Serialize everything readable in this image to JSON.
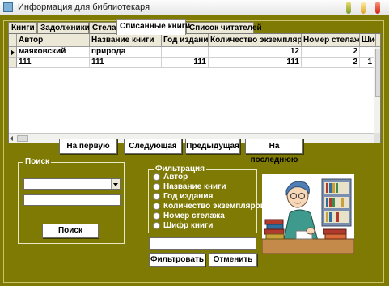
{
  "window": {
    "title": "Информация для библиотекаря"
  },
  "tabs": [
    {
      "label": "Книги"
    },
    {
      "label": "Задолжники"
    },
    {
      "label": "Стелаж"
    },
    {
      "label": "Списанные книги",
      "active": true
    },
    {
      "label": "Список читателей"
    }
  ],
  "grid": {
    "columns": [
      "Автор",
      "Название книги",
      "Год издания",
      "Количество экземпляров",
      "Номер стелажа",
      "Шифр"
    ],
    "rows": [
      {
        "current": true,
        "cells": [
          "маяковский",
          "природа",
          "",
          "12",
          "2",
          ""
        ]
      },
      {
        "current": false,
        "cells": [
          "111",
          "111",
          "111",
          "111",
          "2",
          "1"
        ]
      }
    ]
  },
  "navigation": {
    "first": "На первую",
    "next": "Следующая",
    "previous": "Предыдущая",
    "last": "На последнюю"
  },
  "search": {
    "group_label": "Поиск",
    "combo_value": "",
    "text_value": "",
    "button_label": "Поиск"
  },
  "filter": {
    "group_label": "Фильтрация",
    "options": [
      "Автор",
      "Название книги",
      "Год издания",
      "Количество экземпляров",
      "Номер стелажа",
      "Шифр книги"
    ],
    "text_value": "",
    "apply_label": "Фильтровать",
    "cancel_label": "Отменить"
  },
  "colors": {
    "background": "#7f7a04",
    "tab_active": "#ffffff",
    "button": "#ffffff"
  },
  "icons": {
    "app": "app-window-icon",
    "illustration": "librarian-illustration"
  }
}
